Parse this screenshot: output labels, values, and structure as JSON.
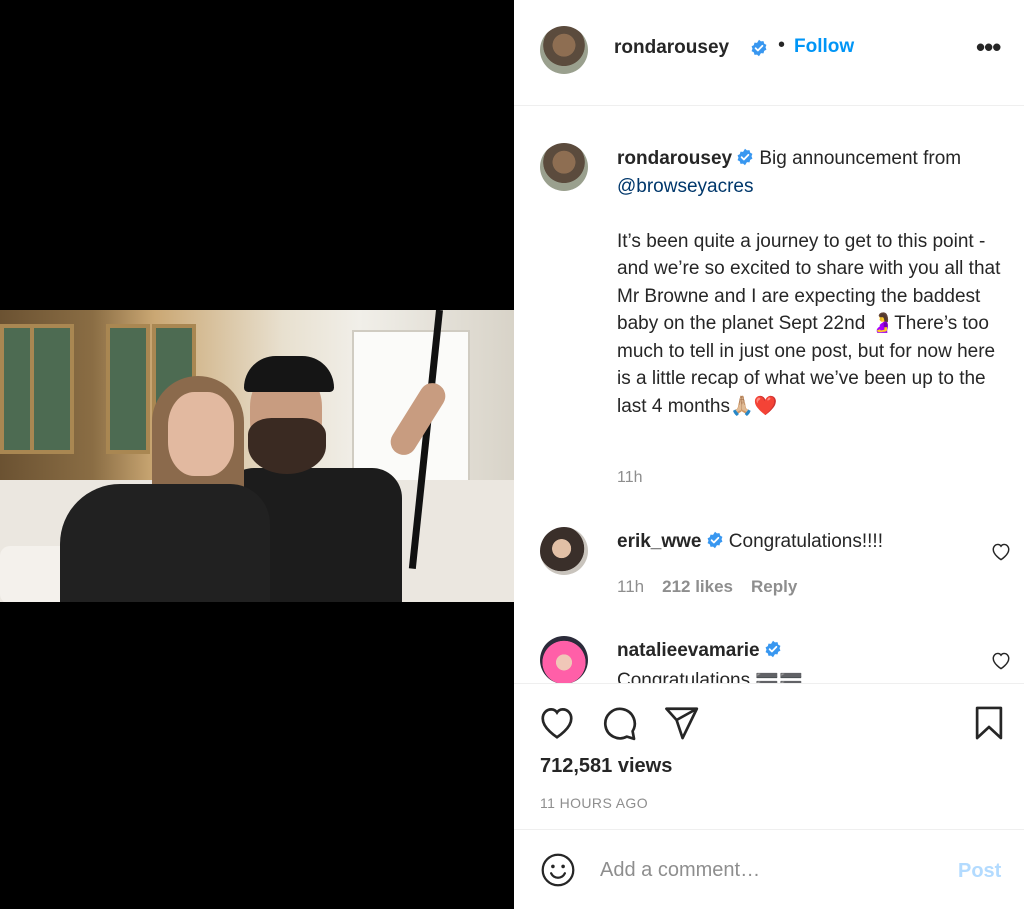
{
  "post": {
    "username": "ronda­rousey",
    "follow_label": "Follow",
    "separator": "•",
    "more_label": "•••"
  },
  "caption": {
    "username": "rondarousey",
    "text_intro": "Big announcement from ",
    "mention": "@browseyacres",
    "body": "It’s been quite a journey to get to this point - and we’re so excited to share with you all that Mr Browne and I are expecting the baddest baby on the planet Sept 22nd 🤰There’s too much to tell in just one post, but for now here is a little recap of what we’ve been up to the last 4 months🙏🏼❤️",
    "time": "11h"
  },
  "comments": [
    {
      "username": "erik_wwe",
      "text": "Congratulations!!!!",
      "time": "11h",
      "likes": "212 likes",
      "reply": "Reply"
    },
    {
      "username": "natalieevamarie",
      "text": "Congratulations 🟰🟰"
    }
  ],
  "stats": {
    "views": "712,581 views",
    "ago": "11 HOURS AGO"
  },
  "add_comment": {
    "placeholder": "Add a comment…",
    "post_label": "Post"
  },
  "colors": {
    "accent": "#0095f6",
    "post_disabled": "#b3dbff",
    "verified": "#3897f0"
  },
  "icons": [
    "verified-badge-icon",
    "more-icon",
    "heart-icon",
    "comment-icon",
    "share-icon",
    "bookmark-icon",
    "smiley-icon"
  ]
}
